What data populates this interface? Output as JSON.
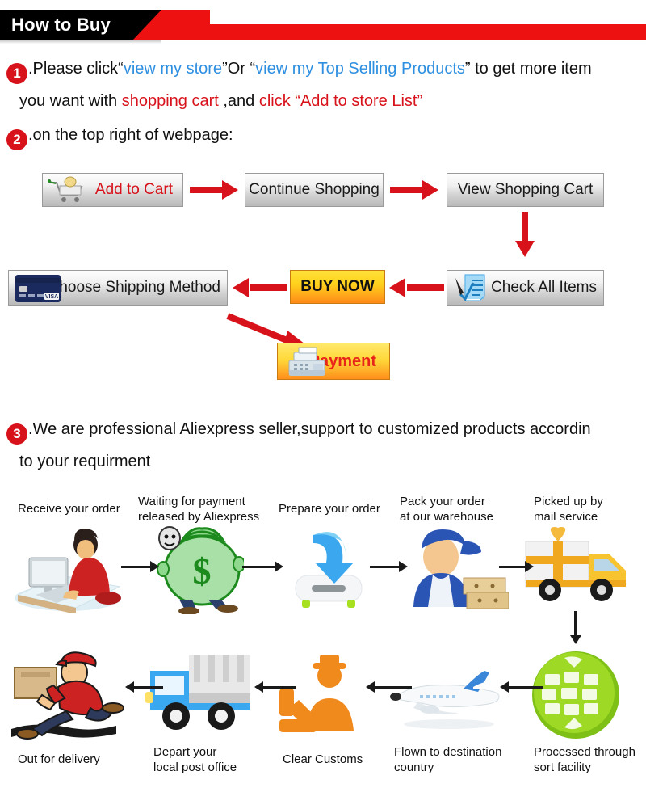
{
  "banner": {
    "title": "How to Buy",
    "black_color": "#000000",
    "red_color": "#ee1111"
  },
  "steps": {
    "one": {
      "number": "1",
      "line1_a": ".Please click“",
      "line1_link1": "view my store",
      "line1_b": "”Or “",
      "line1_link2": "view my Top Selling Products",
      "line1_c": "” to get more item",
      "line2_a": "you want with ",
      "line2_red1": "shopping cart",
      "line2_b": " ,and ",
      "line2_red2": "click “Add to store List”"
    },
    "two": {
      "number": "2",
      "text": ".on the top right of webpage:"
    },
    "three": {
      "number": "3",
      "line1": ".We are professional Aliexpress seller,support to customized products accordin",
      "line2": "to your requirment"
    }
  },
  "flow_buttons": {
    "add_to_cart": "Add to Cart",
    "continue_shopping": "Continue Shopping",
    "view_shopping_cart": "View Shopping Cart",
    "check_all_items": "Check All Items",
    "buy_now": "BUY NOW",
    "choose_shipping": "Choose Shipping Method",
    "payment": "Payment"
  },
  "process_flow": {
    "row1": [
      "Receive your order",
      "Waiting for payment\nreleased by Aliexpress",
      "Prepare your order",
      "Pack your order\nat our warehouse",
      "Picked up by\nmail service"
    ],
    "row2": [
      "Out for delivery",
      "Depart your\nlocal post office",
      "Clear Customs",
      "Flown to destination\ncountry",
      "Processed through\nsort facility"
    ]
  },
  "colors": {
    "accent_red": "#d8121a",
    "link_blue": "#2f8fe0",
    "banner_red": "#ee1111",
    "button_orange": "#ff8a19",
    "globe_green": "#8fd117"
  }
}
